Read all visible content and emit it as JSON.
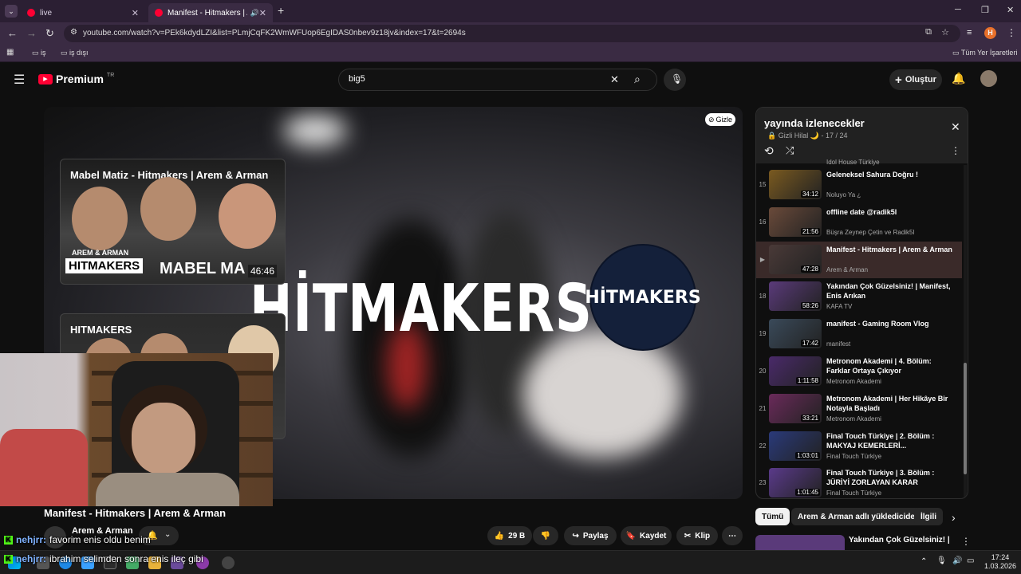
{
  "browser": {
    "tabs": [
      {
        "label": "live",
        "active": false
      },
      {
        "label": "Manifest - Hitmakers | Arem",
        "active": true
      }
    ],
    "url": "youtube.com/watch?v=PEk6kdydLZI&list=PLmjCqFK2WmWFUop6EgIDAS0nbev9z18jv&index=17&t=2694s",
    "bookmarks": {
      "left1": "iş",
      "left2": "iş dışı",
      "right": "Tüm Yer İşaretleri"
    },
    "profile_initial": "H"
  },
  "youtube": {
    "logo": "Premium",
    "logo_sup": "TR",
    "search_value": "big5",
    "create_label": "Oluştur"
  },
  "player": {
    "hide_label": "Gizle",
    "overlay_title": "HİTMAKERS",
    "badge_text": "HİTMAKERS",
    "card1_title": "Mabel Matiz - Hitmakers | Arem & Arman",
    "card1_tag_top": "AREM & ARMAN",
    "card1_tag_main": "HITMAKERS",
    "card1_name": "MABEL MA",
    "card1_duration": "46:46",
    "card2_title": "HITMAKERS"
  },
  "video": {
    "title": "Manifest - Hitmakers | Arem & Arman",
    "channel": "Arem & Arman",
    "likes": "29 B",
    "share": "Paylaş",
    "save": "Kaydet",
    "clip": "Klip"
  },
  "chat": [
    {
      "user": "nehjrr:",
      "text": "favorim enis oldu benim"
    },
    {
      "user": "nehjrr:",
      "text": "ibrahim selimden sonra enis ileç gibi"
    }
  ],
  "playlist": {
    "title": "yayında izlenecekler",
    "meta_private": "Gizli",
    "meta_owner": "Hilal 🌙",
    "meta_pos": "- 17 / 24",
    "partial_channel": "Idol House Türkiye",
    "items": [
      {
        "idx": "15",
        "title": "Geleneksel Sahura Doğru !",
        "channel": "Noluyo Ya ¿",
        "dur": "34:12",
        "color": "#7a5a20"
      },
      {
        "idx": "16",
        "title": "offline date @radik5l",
        "channel": "Büşra Zeynep Çetin ve Radik5l",
        "dur": "21:56",
        "color": "#6a4a3a"
      },
      {
        "idx": "▶",
        "title": "Manifest - Hitmakers | Arem & Arman",
        "channel": "Arem & Arman",
        "dur": "47:28",
        "color": "#4a3a38",
        "selected": true
      },
      {
        "idx": "18",
        "title": "Yakından Çok Güzelsiniz! | Manifest, Enis Arıkan",
        "channel": "KAFA TV",
        "dur": "58:26",
        "color": "#5a3a7a"
      },
      {
        "idx": "19",
        "title": "manifest - Gaming Room Vlog",
        "channel": "manifest",
        "dur": "17:42",
        "color": "#3a4a5a"
      },
      {
        "idx": "20",
        "title": "Metronom Akademi | 4. Bölüm: Farklar Ortaya Çıkıyor",
        "channel": "Metronom Akademi",
        "dur": "1:11:58",
        "color": "#4a2a6a"
      },
      {
        "idx": "21",
        "title": "Metronom Akademi | Her Hikâye Bir Notayla Başladı",
        "channel": "Metronom Akademi",
        "dur": "33:21",
        "color": "#6a2a5a"
      },
      {
        "idx": "22",
        "title": "Final Touch Türkiye | 2. Bölüm : MAKYAJ KEMERLERİ...",
        "channel": "Final Touch Türkiye",
        "dur": "1:03:01",
        "color": "#2a3a7a"
      },
      {
        "idx": "23",
        "title": "Final Touch Türkiye | 3. Bölüm : JÜRİYİ ZORLAYAN KARAR",
        "channel": "Final Touch Türkiye",
        "dur": "1:01:45",
        "color": "#5a3a8a"
      }
    ]
  },
  "chips": [
    "Tümü",
    "Arem & Arman adlı yüklediciden",
    "İlgili"
  ],
  "related_title": "Yakından Çok Güzelsiniz! |",
  "taskbar": {
    "time": "17:24",
    "date": "1.03.2026"
  },
  "colors": {
    "accent": "#ff0033",
    "browser_frame": "#3a2b43"
  }
}
